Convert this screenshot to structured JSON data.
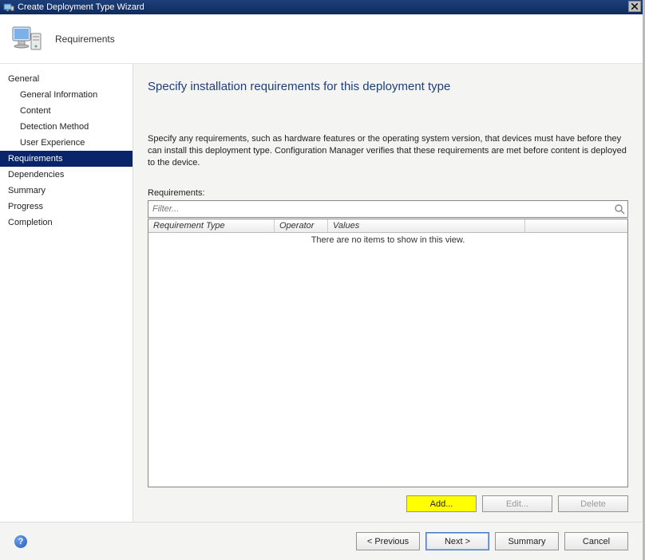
{
  "window": {
    "title": "Create Deployment Type Wizard"
  },
  "header": {
    "title": "Requirements"
  },
  "sidebar": {
    "items": [
      {
        "label": "General",
        "indent": false,
        "active": false
      },
      {
        "label": "General Information",
        "indent": true,
        "active": false
      },
      {
        "label": "Content",
        "indent": true,
        "active": false
      },
      {
        "label": "Detection Method",
        "indent": true,
        "active": false
      },
      {
        "label": "User Experience",
        "indent": true,
        "active": false
      },
      {
        "label": "Requirements",
        "indent": false,
        "active": true
      },
      {
        "label": "Dependencies",
        "indent": false,
        "active": false
      },
      {
        "label": "Summary",
        "indent": false,
        "active": false
      },
      {
        "label": "Progress",
        "indent": false,
        "active": false
      },
      {
        "label": "Completion",
        "indent": false,
        "active": false
      }
    ]
  },
  "main": {
    "heading": "Specify installation requirements for this deployment type",
    "description": "Specify any requirements, such as hardware features or the operating system version, that devices must have before they can install this deployment type. Configuration Manager verifies that these requirements are met before content is deployed to the device.",
    "requirements_label": "Requirements:",
    "filter_placeholder": "Filter...",
    "columns": {
      "c1": "Requirement Type",
      "c2": "Operator",
      "c3": "Values"
    },
    "empty_text": "There are no items to show in this view.",
    "buttons": {
      "add": "Add...",
      "edit": "Edit...",
      "delete": "Delete"
    }
  },
  "footer": {
    "help_tooltip": "?",
    "previous": "< Previous",
    "next": "Next >",
    "summary": "Summary",
    "cancel": "Cancel"
  }
}
